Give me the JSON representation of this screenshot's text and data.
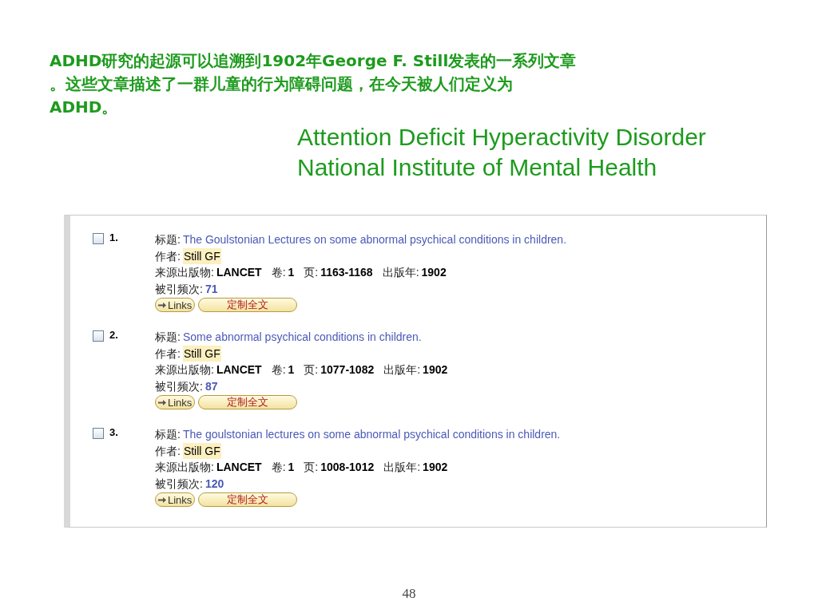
{
  "intro": {
    "lines": [
      "ADHD研究的起源可以追溯到1902年George F. Still发表的一系列文章",
      "。这些文章描述了一群儿童的行为障碍问题，在今天被人们定义为",
      "ADHD。"
    ]
  },
  "subtitle": [
    "Attention Deficit Hyperactivity Disorder",
    "National Institute of Mental Health"
  ],
  "results": [
    {
      "checked": false,
      "number": "1.",
      "title_label": "标题:",
      "title": "The Goulstonian Lectures on some abnormal psychical conditions in children.",
      "author_label": "作者:",
      "author": "Still GF",
      "source_label": "来源出版物:",
      "source": "LANCET",
      "volume_label": "卷:",
      "volume": "1",
      "pages_label": "页:",
      "pages": "1163-1168",
      "year_label": "出版年:",
      "year": "1902",
      "cited_label": "被引频次:",
      "cited": "71",
      "links_button": "Links",
      "fulltext_button": "定制全文"
    },
    {
      "checked": false,
      "number": "2.",
      "title_label": "标题:",
      "title": "Some abnormal psychical conditions in children.",
      "author_label": "作者:",
      "author": "Still GF",
      "source_label": "来源出版物:",
      "source": "LANCET",
      "volume_label": "卷:",
      "volume": "1",
      "pages_label": "页:",
      "pages": "1077-1082",
      "year_label": "出版年:",
      "year": "1902",
      "cited_label": "被引频次:",
      "cited": "87",
      "links_button": "Links",
      "fulltext_button": "定制全文"
    },
    {
      "checked": false,
      "number": "3.",
      "title_label": "标题:",
      "title": "The goulstonian lectures on some abnormal psychical conditions in children.",
      "author_label": "作者:",
      "author": "Still GF",
      "source_label": "来源出版物:",
      "source": "LANCET",
      "volume_label": "卷:",
      "volume": "1",
      "pages_label": "页:",
      "pages": "1008-1012",
      "year_label": "出版年:",
      "year": "1902",
      "cited_label": "被引频次:",
      "cited": "120",
      "links_button": "Links",
      "fulltext_button": "定制全文"
    }
  ],
  "page_number": "48"
}
